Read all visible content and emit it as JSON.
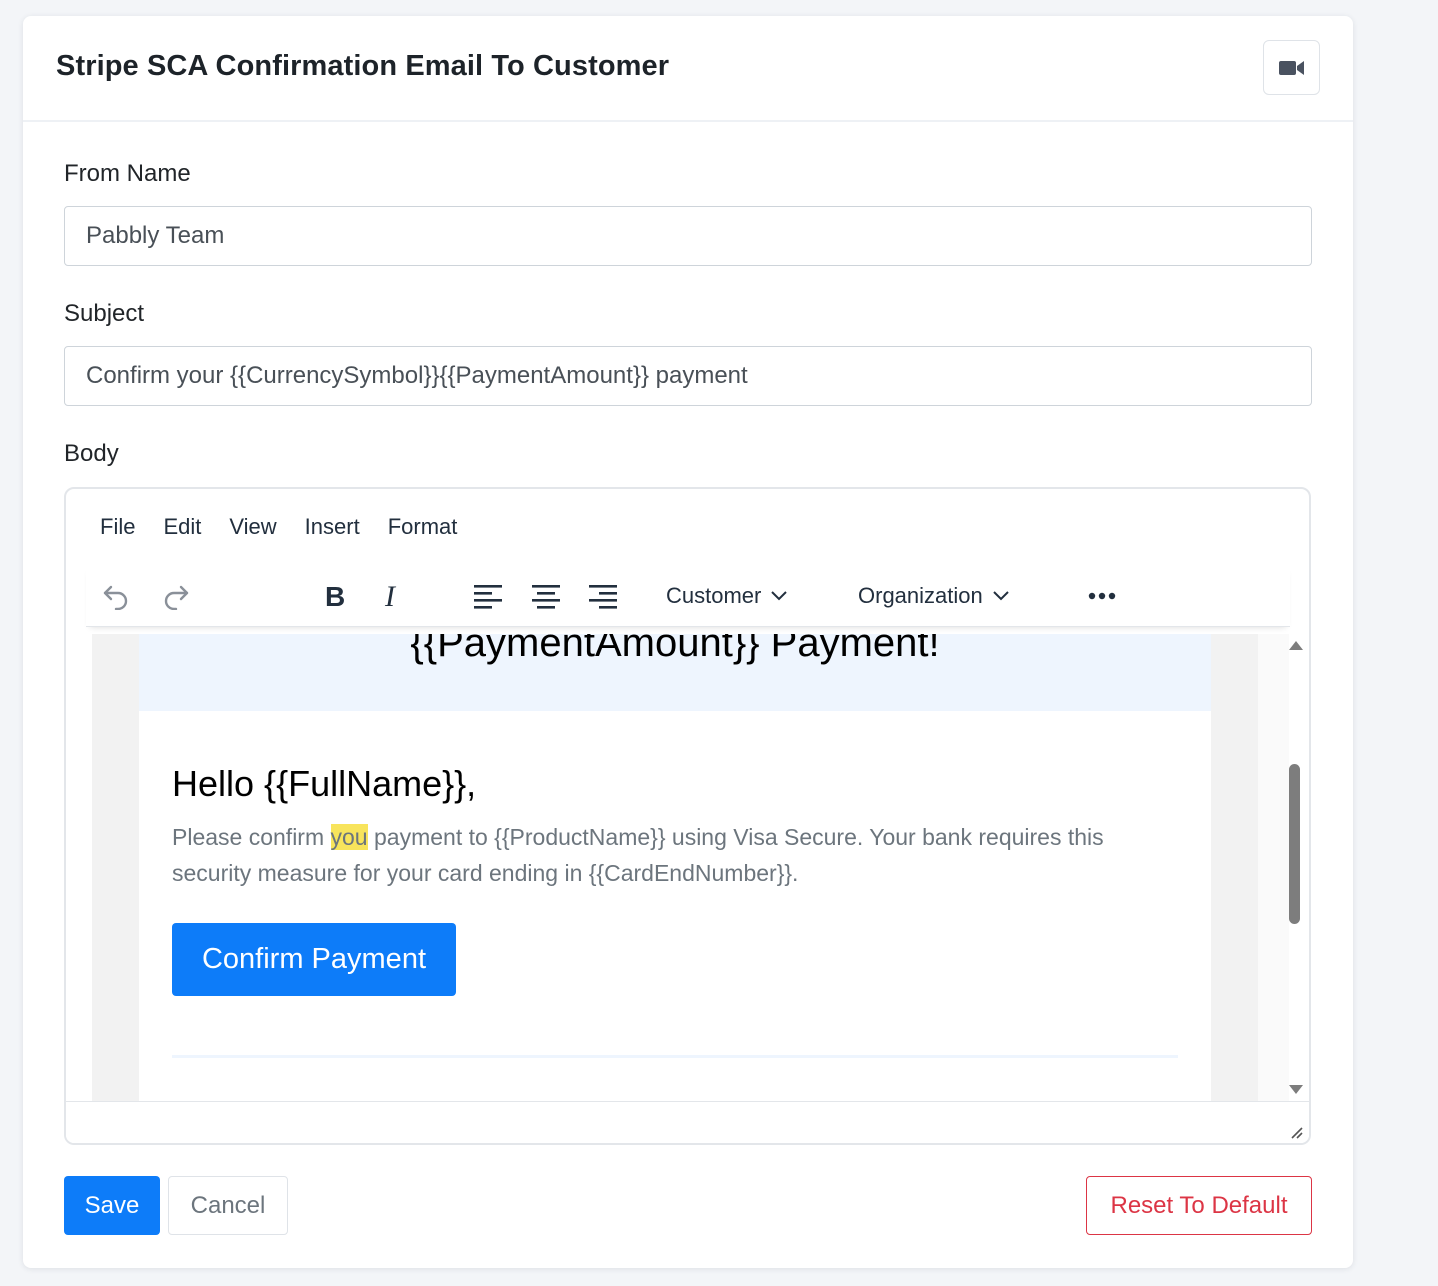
{
  "card": {
    "title": "Stripe SCA Confirmation Email To Customer",
    "video_icon": "video-camera-icon"
  },
  "form": {
    "from_name_label": "From Name",
    "from_name_value": "Pabbly Team",
    "subject_label": "Subject",
    "subject_value": "Confirm your {{CurrencySymbol}}{{PaymentAmount}} payment",
    "body_label": "Body"
  },
  "editor": {
    "menu": [
      "File",
      "Edit",
      "View",
      "Insert",
      "Format"
    ],
    "toolbar": {
      "undo_icon": "undo-icon",
      "redo_icon": "redo-icon",
      "bold_icon": "bold-icon",
      "italic_icon": "italic-icon",
      "align_left_icon": "align-left-icon",
      "align_center_icon": "align-center-icon",
      "align_right_icon": "align-right-icon",
      "customer_dropdown": "Customer",
      "organization_dropdown": "Organization",
      "more_icon": "more-horizontal-icon"
    },
    "content": {
      "header_title": "{{PaymentAmount}} Payment!",
      "greeting": "Hello {{FullName}},",
      "paragraph_before": "Please confirm ",
      "paragraph_highlight": "you",
      "paragraph_after": " payment to {{ProductName}} using Visa Secure. Your bank requires this security measure for your card ending in {{CardEndNumber}}.",
      "button_label": "Confirm Payment"
    }
  },
  "actions": {
    "save_label": "Save",
    "cancel_label": "Cancel",
    "reset_label": "Reset To Default"
  },
  "colors": {
    "primary": "#0d7cf9",
    "danger": "#dc3545",
    "highlight": "#f8e45c",
    "email_header_bg": "#eef5fe"
  }
}
